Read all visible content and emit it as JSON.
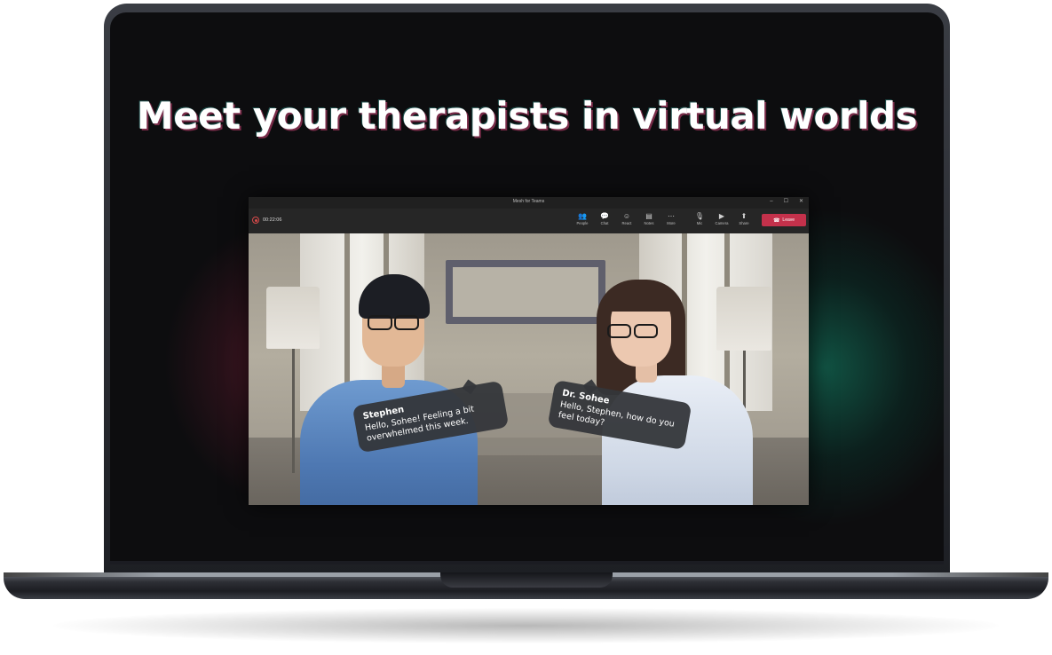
{
  "headline": "Meet your therapists in virtual worlds",
  "app": {
    "window_title": "Mesh for Teams",
    "window_controls": [
      "–",
      "☐",
      "✕"
    ],
    "timer": "00:22:06",
    "toolbar": [
      {
        "label": "People",
        "icon": "people-icon",
        "glyph": "👥"
      },
      {
        "label": "Chat",
        "icon": "chat-icon",
        "glyph": "💬"
      },
      {
        "label": "React",
        "icon": "react-icon",
        "glyph": "☺"
      },
      {
        "label": "Notes",
        "icon": "notes-icon",
        "glyph": "▤"
      },
      {
        "label": "More",
        "icon": "more-icon",
        "glyph": "⋯"
      },
      {
        "label": "Mic",
        "icon": "mic-icon",
        "glyph": "🎙"
      },
      {
        "label": "Camera",
        "icon": "camera-icon",
        "glyph": "▶"
      },
      {
        "label": "Share",
        "icon": "share-icon",
        "glyph": "⬆"
      }
    ],
    "leave_label": "Leave",
    "leave_color": "#c4314b"
  },
  "scene": {
    "bubble_left": {
      "name": "Stephen",
      "text": "Hello, Sohee! Feeling a bit overwhelmed this week."
    },
    "bubble_right": {
      "name": "Dr. Sohee",
      "text": "Hello, Stephen, how do you feel today?"
    }
  },
  "colors": {
    "glow_left": "#a0284a",
    "glow_right": "#148c6e"
  }
}
